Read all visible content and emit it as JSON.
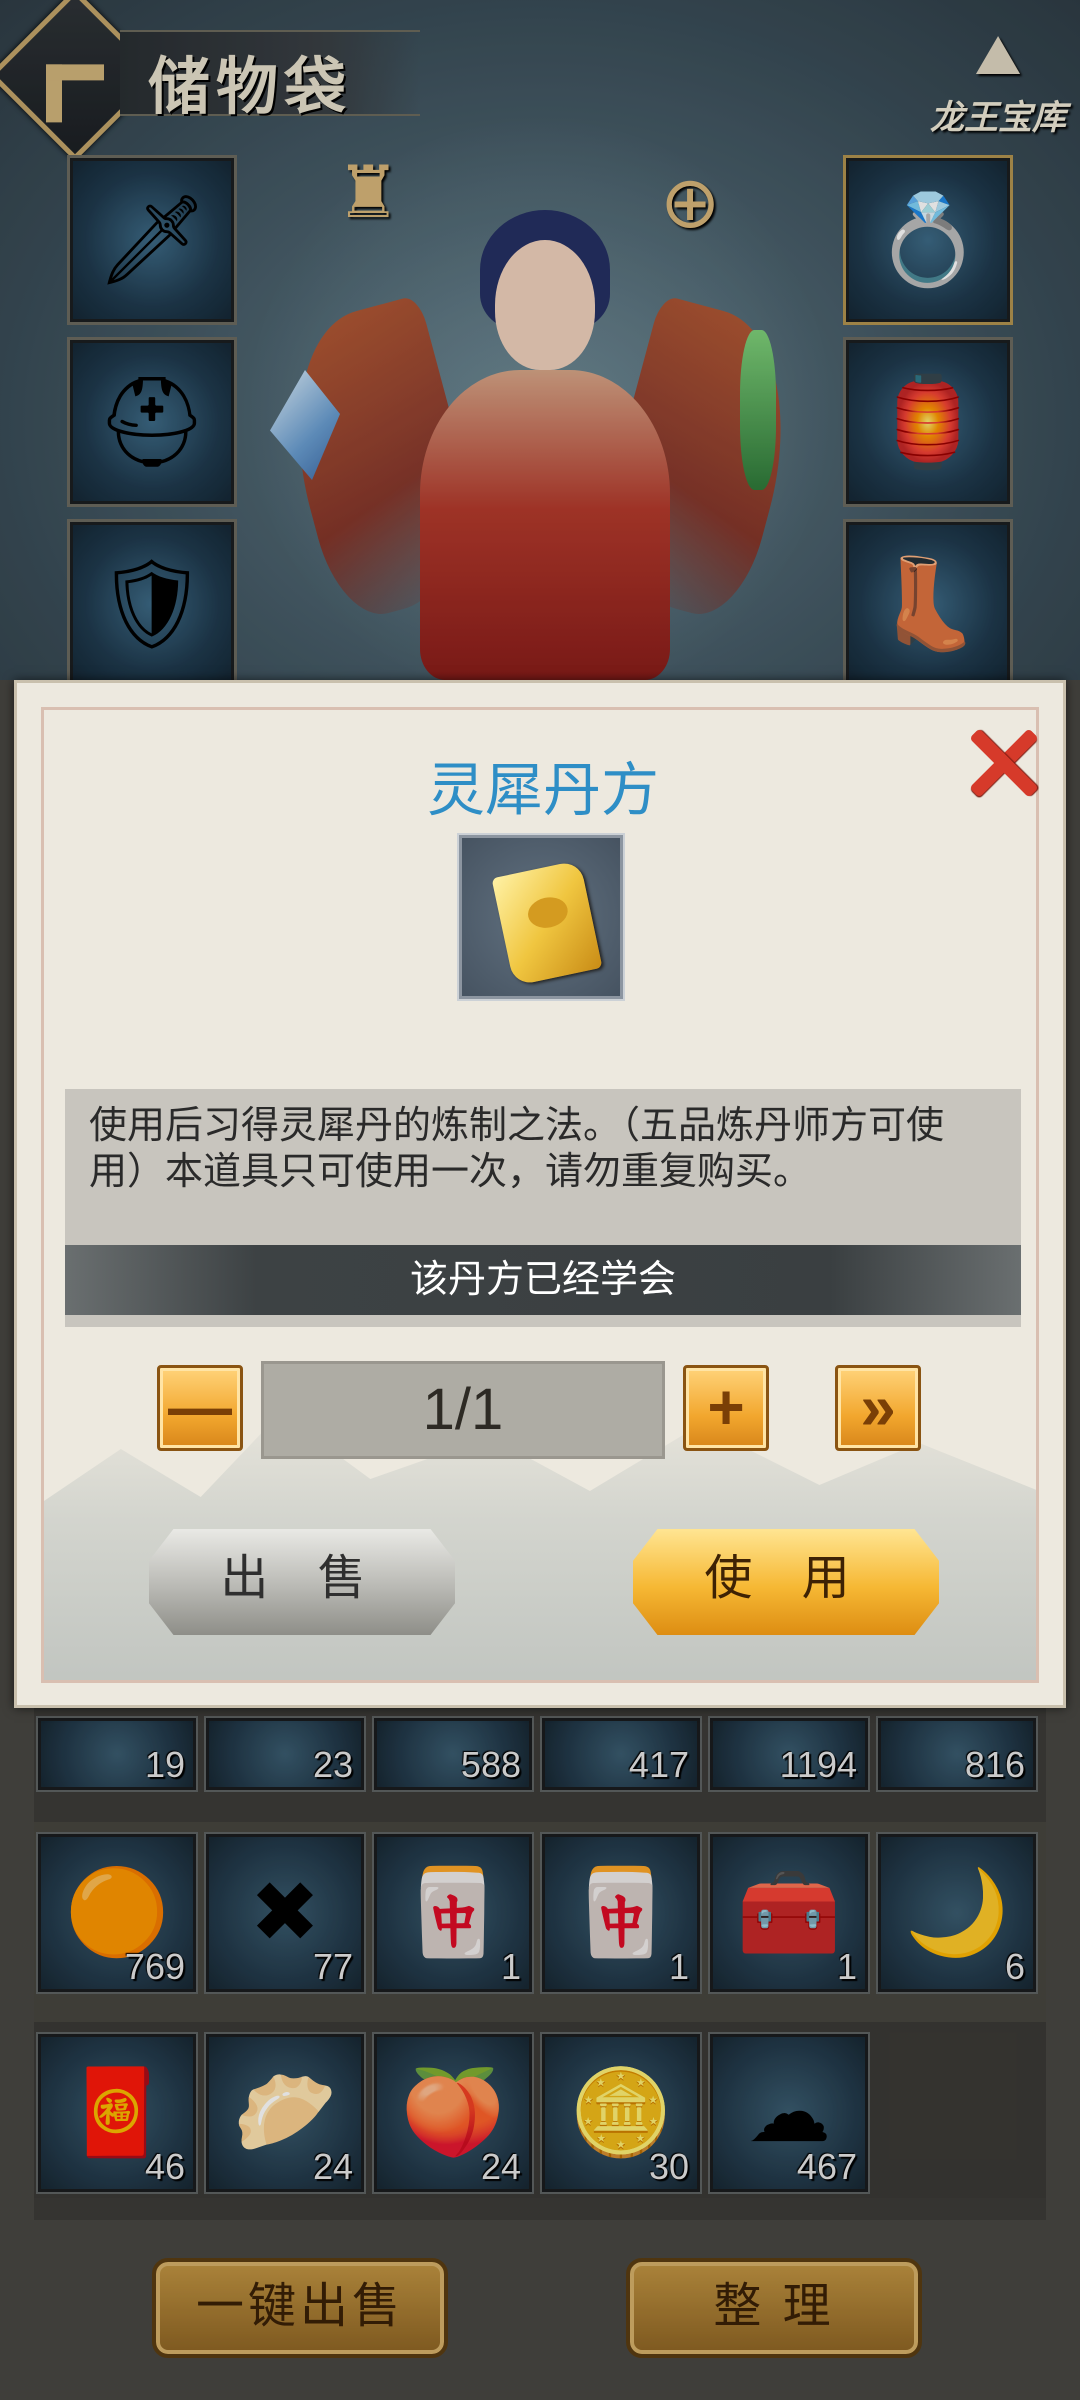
{
  "header": {
    "back_icon": "chevron-left-icon",
    "title": "储物袋",
    "logo_text": "龙王宝库"
  },
  "equipment": {
    "left_slots": [
      "sword-icon",
      "helmet-icon",
      "armor-icon"
    ],
    "right_slots": [
      "ring-icon",
      "lantern-icon",
      "boots-icon"
    ],
    "top_icons": [
      "fashion-icon",
      "zoom-in-icon"
    ]
  },
  "inventory": {
    "row1": [
      "19",
      "23",
      "588",
      "417",
      "1194",
      "816"
    ],
    "row2": [
      "769",
      "77",
      "1",
      "1",
      "1",
      "6"
    ],
    "row3": [
      "46",
      "24",
      "24",
      "30",
      "467"
    ]
  },
  "bottom_buttons": {
    "sell_all": "一键出售",
    "arrange": "整 理"
  },
  "modal": {
    "title": "灵犀丹方",
    "item_icon": "recipe-scroll-icon",
    "description": "使用后习得灵犀丹的炼制之法。（五品炼丹师方可使用）本道具只可使用一次，请勿重复购买。",
    "status": "该丹方已经学会",
    "quantity": "1/1",
    "minus_label": "—",
    "plus_label": "+",
    "max_label": "»",
    "sell_label": "出 售",
    "use_label": "使 用",
    "close_icon": "close-icon"
  },
  "colors": {
    "modal_title": "#2e8ec6",
    "accent_gold": "#f2a72e",
    "close_red": "#d63a2a"
  }
}
